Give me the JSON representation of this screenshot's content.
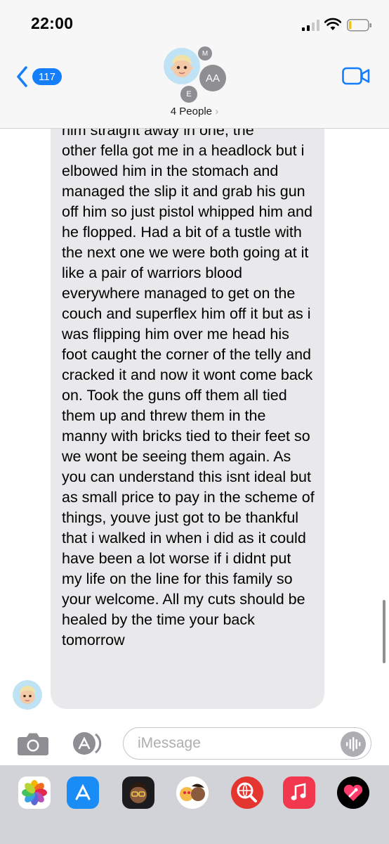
{
  "status_bar": {
    "time": "22:00"
  },
  "header": {
    "back_count": "117",
    "avatars": {
      "m": "M",
      "aa": "AA",
      "e": "E"
    },
    "group_name": "4 People",
    "group_chevron": "›"
  },
  "message": {
    "text_top_clipped": "him straight away in one, the",
    "text": "other fella got me in a headlock but i elbowed him in the stomach and managed the slip it and grab his gun off him so just pistol whipped him and he flopped. Had a bit of a tustle with the next one we were both going at it like a pair of warriors blood everywhere managed to get on the couch and superflex him off it but as i was flipping him over me head his foot caught the corner of the telly and cracked it and now it wont come back on. Took the guns off them all tied them up and threw them in the manny with bricks tied to their feet so we wont be seeing them again. As you can understand this isnt ideal but as small price to pay in the scheme of things, youve just got to be thankful that i walked in when i did as it could have been a lot worse if i didnt put my life on the line for this family so your welcome. All my cuts should be healed by the time your back tomorrow"
  },
  "composer": {
    "placeholder": "iMessage"
  },
  "app_tray": {
    "icons": [
      "photos-icon",
      "app-store-icon",
      "memoji-icon",
      "memoji-stickers-icon",
      "web-search-icon",
      "music-icon",
      "digital-touch-icon"
    ]
  },
  "colors": {
    "accent": "#147efb",
    "bubble": "#e9e9eb",
    "header_bg": "#f7f7f7",
    "tray_bg": "#d1d3d9"
  }
}
